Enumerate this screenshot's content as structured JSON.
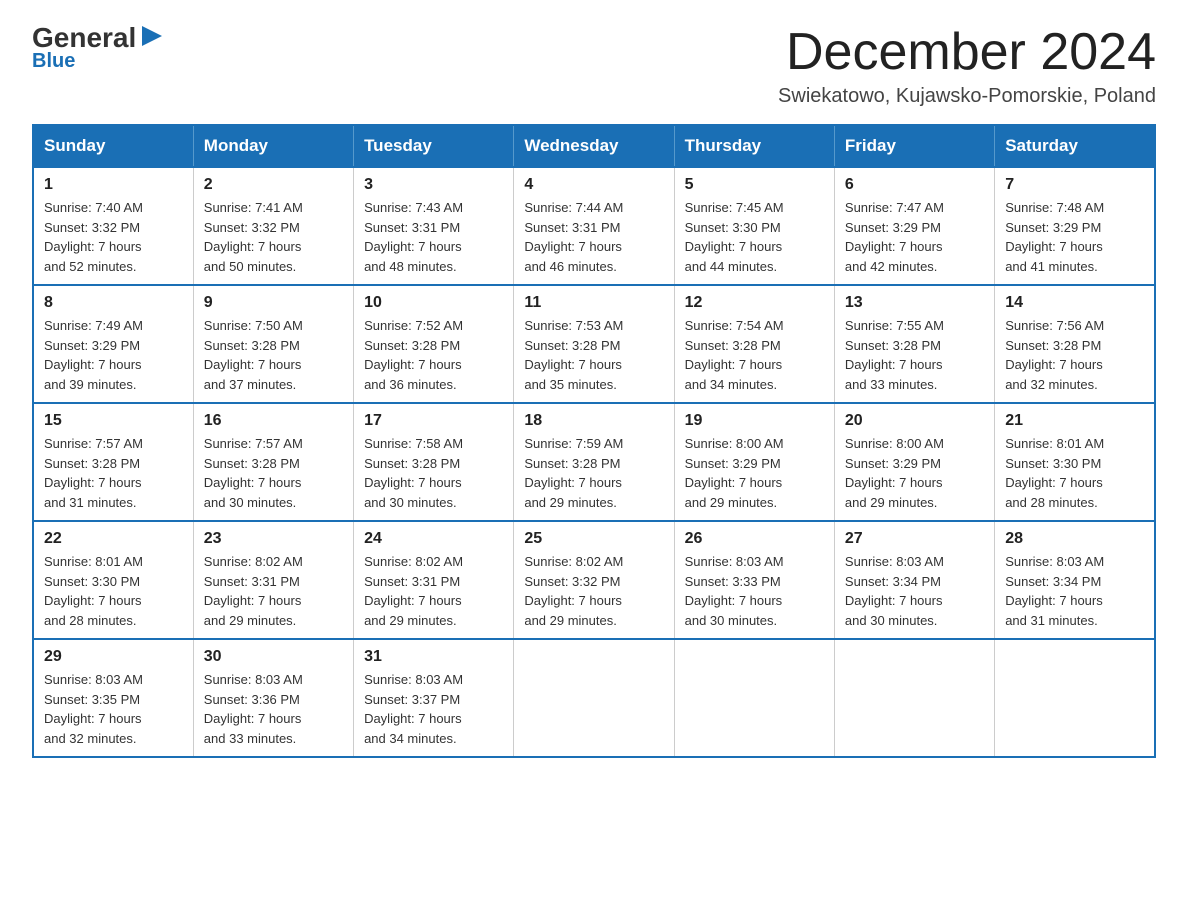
{
  "logo": {
    "general": "General",
    "arrow": "▶",
    "blue": "Blue"
  },
  "title": {
    "month": "December 2024",
    "location": "Swiekatowo, Kujawsko-Pomorskie, Poland"
  },
  "weekdays": [
    "Sunday",
    "Monday",
    "Tuesday",
    "Wednesday",
    "Thursday",
    "Friday",
    "Saturday"
  ],
  "weeks": [
    [
      {
        "day": "1",
        "sunrise": "7:40 AM",
        "sunset": "3:32 PM",
        "daylight": "7 hours and 52 minutes."
      },
      {
        "day": "2",
        "sunrise": "7:41 AM",
        "sunset": "3:32 PM",
        "daylight": "7 hours and 50 minutes."
      },
      {
        "day": "3",
        "sunrise": "7:43 AM",
        "sunset": "3:31 PM",
        "daylight": "7 hours and 48 minutes."
      },
      {
        "day": "4",
        "sunrise": "7:44 AM",
        "sunset": "3:31 PM",
        "daylight": "7 hours and 46 minutes."
      },
      {
        "day": "5",
        "sunrise": "7:45 AM",
        "sunset": "3:30 PM",
        "daylight": "7 hours and 44 minutes."
      },
      {
        "day": "6",
        "sunrise": "7:47 AM",
        "sunset": "3:29 PM",
        "daylight": "7 hours and 42 minutes."
      },
      {
        "day": "7",
        "sunrise": "7:48 AM",
        "sunset": "3:29 PM",
        "daylight": "7 hours and 41 minutes."
      }
    ],
    [
      {
        "day": "8",
        "sunrise": "7:49 AM",
        "sunset": "3:29 PM",
        "daylight": "7 hours and 39 minutes."
      },
      {
        "day": "9",
        "sunrise": "7:50 AM",
        "sunset": "3:28 PM",
        "daylight": "7 hours and 37 minutes."
      },
      {
        "day": "10",
        "sunrise": "7:52 AM",
        "sunset": "3:28 PM",
        "daylight": "7 hours and 36 minutes."
      },
      {
        "day": "11",
        "sunrise": "7:53 AM",
        "sunset": "3:28 PM",
        "daylight": "7 hours and 35 minutes."
      },
      {
        "day": "12",
        "sunrise": "7:54 AM",
        "sunset": "3:28 PM",
        "daylight": "7 hours and 34 minutes."
      },
      {
        "day": "13",
        "sunrise": "7:55 AM",
        "sunset": "3:28 PM",
        "daylight": "7 hours and 33 minutes."
      },
      {
        "day": "14",
        "sunrise": "7:56 AM",
        "sunset": "3:28 PM",
        "daylight": "7 hours and 32 minutes."
      }
    ],
    [
      {
        "day": "15",
        "sunrise": "7:57 AM",
        "sunset": "3:28 PM",
        "daylight": "7 hours and 31 minutes."
      },
      {
        "day": "16",
        "sunrise": "7:57 AM",
        "sunset": "3:28 PM",
        "daylight": "7 hours and 30 minutes."
      },
      {
        "day": "17",
        "sunrise": "7:58 AM",
        "sunset": "3:28 PM",
        "daylight": "7 hours and 30 minutes."
      },
      {
        "day": "18",
        "sunrise": "7:59 AM",
        "sunset": "3:28 PM",
        "daylight": "7 hours and 29 minutes."
      },
      {
        "day": "19",
        "sunrise": "8:00 AM",
        "sunset": "3:29 PM",
        "daylight": "7 hours and 29 minutes."
      },
      {
        "day": "20",
        "sunrise": "8:00 AM",
        "sunset": "3:29 PM",
        "daylight": "7 hours and 29 minutes."
      },
      {
        "day": "21",
        "sunrise": "8:01 AM",
        "sunset": "3:30 PM",
        "daylight": "7 hours and 28 minutes."
      }
    ],
    [
      {
        "day": "22",
        "sunrise": "8:01 AM",
        "sunset": "3:30 PM",
        "daylight": "7 hours and 28 minutes."
      },
      {
        "day": "23",
        "sunrise": "8:02 AM",
        "sunset": "3:31 PM",
        "daylight": "7 hours and 29 minutes."
      },
      {
        "day": "24",
        "sunrise": "8:02 AM",
        "sunset": "3:31 PM",
        "daylight": "7 hours and 29 minutes."
      },
      {
        "day": "25",
        "sunrise": "8:02 AM",
        "sunset": "3:32 PM",
        "daylight": "7 hours and 29 minutes."
      },
      {
        "day": "26",
        "sunrise": "8:03 AM",
        "sunset": "3:33 PM",
        "daylight": "7 hours and 30 minutes."
      },
      {
        "day": "27",
        "sunrise": "8:03 AM",
        "sunset": "3:34 PM",
        "daylight": "7 hours and 30 minutes."
      },
      {
        "day": "28",
        "sunrise": "8:03 AM",
        "sunset": "3:34 PM",
        "daylight": "7 hours and 31 minutes."
      }
    ],
    [
      {
        "day": "29",
        "sunrise": "8:03 AM",
        "sunset": "3:35 PM",
        "daylight": "7 hours and 32 minutes."
      },
      {
        "day": "30",
        "sunrise": "8:03 AM",
        "sunset": "3:36 PM",
        "daylight": "7 hours and 33 minutes."
      },
      {
        "day": "31",
        "sunrise": "8:03 AM",
        "sunset": "3:37 PM",
        "daylight": "7 hours and 34 minutes."
      },
      null,
      null,
      null,
      null
    ]
  ],
  "labels": {
    "sunrise": "Sunrise:",
    "sunset": "Sunset:",
    "daylight": "Daylight:"
  }
}
